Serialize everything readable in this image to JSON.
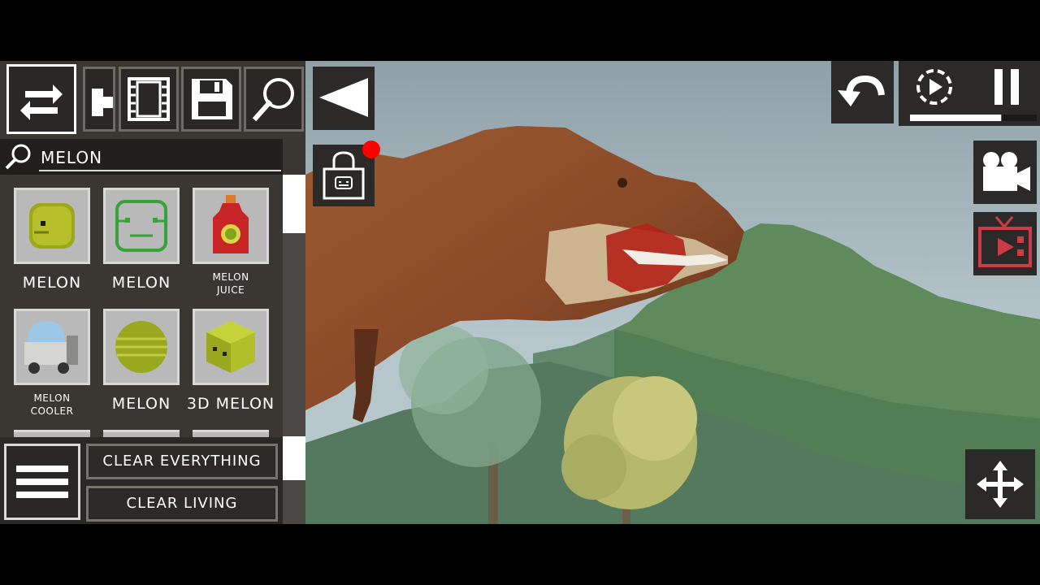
{
  "search": {
    "query": "MELON"
  },
  "items": [
    {
      "label": "MELON",
      "size": "big",
      "icon": "melon-face-icon"
    },
    {
      "label": "MELON",
      "size": "big",
      "icon": "melon-outline-icon"
    },
    {
      "label": "MELON\nJUICE",
      "size": "small",
      "icon": "juice-bottle-icon"
    },
    {
      "label": "MELON\nCOOLER",
      "size": "small",
      "icon": "cooler-machine-icon"
    },
    {
      "label": "MELON",
      "size": "big",
      "icon": "round-melon-icon"
    },
    {
      "label": "3D MELON",
      "size": "big",
      "icon": "cube-melon-icon"
    }
  ],
  "buttons": {
    "clear_everything": "CLEAR EVERYTHING",
    "clear_living": "CLEAR LIVING"
  },
  "timescale": {
    "level": 0.72
  },
  "colors": {
    "panel": "#3a3631",
    "accent_alert": "#ff0000",
    "tv_icon": "#cc3b47"
  }
}
